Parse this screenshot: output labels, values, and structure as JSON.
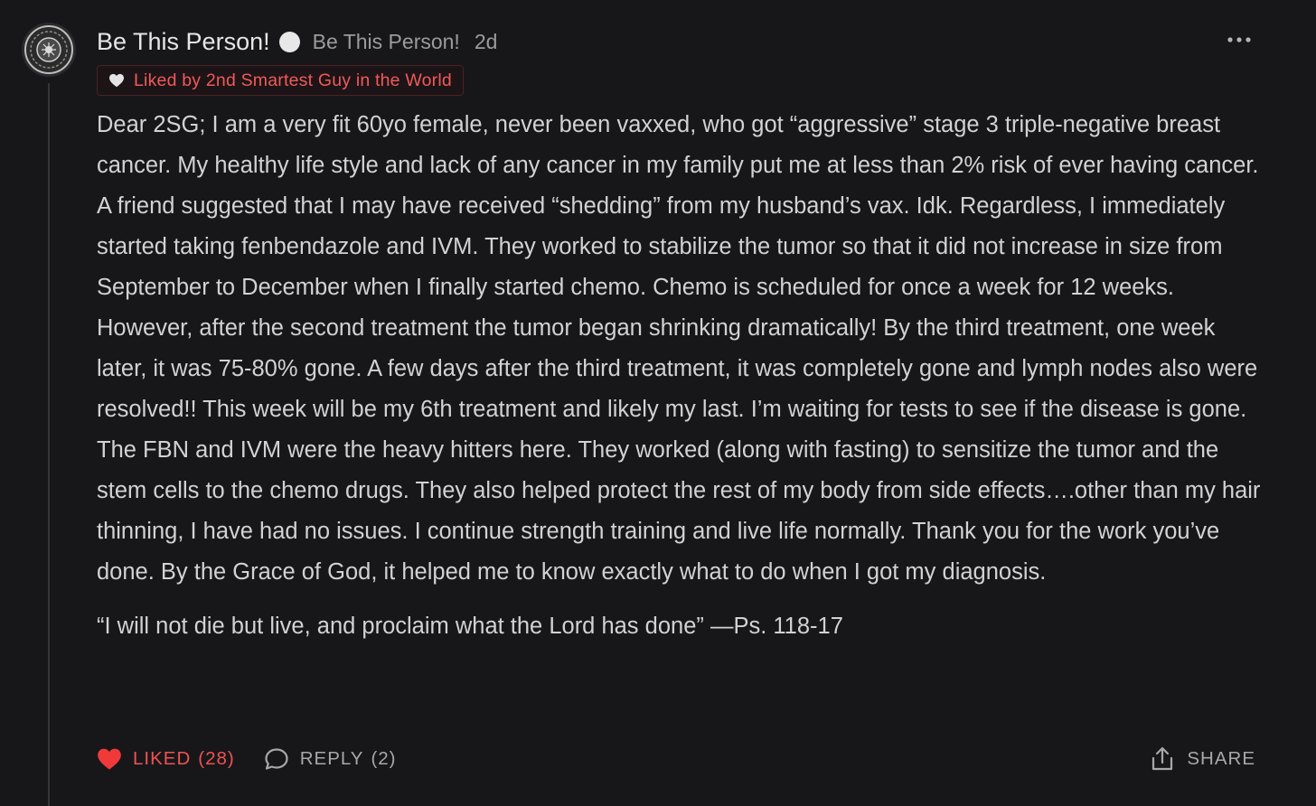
{
  "comment": {
    "author_name": "Be This Person!",
    "author_handle": "Be This Person!",
    "timestamp": "2d",
    "liked_by": "Liked by 2nd Smartest Guy in the World",
    "body_paragraphs": [
      "Dear 2SG; I am a very fit 60yo female, never been vaxxed, who got “aggressive” stage 3 triple-negative breast cancer. My healthy life style and lack of any cancer in my family put me at less than 2% risk of ever having cancer. A friend suggested that I may have received “shedding” from my husband’s vax. Idk. Regardless, I immediately started taking fenbendazole and IVM. They worked to stabilize the tumor so that it did not increase in size from September to December when I finally started chemo. Chemo is scheduled for once a week for 12 weeks. However, after the second treatment the tumor began shrinking dramatically! By the third treatment, one week later, it was 75-80% gone. A few days after the third treatment, it was completely gone and lymph nodes also were resolved!! This week will be my 6th treatment and likely my last. I’m waiting for tests to see if the disease is gone. The FBN and IVM were the heavy hitters here. They worked (along with fasting) to sensitize the tumor and the stem cells to the chemo drugs. They also helped protect the rest of my body from side effects….other than my hair thinning, I have had no issues. I continue strength training and live life normally. Thank you for the work you’ve done. By the Grace of God, it helped me to know exactly what to do when I got my diagnosis.",
      "“I will not die but live, and proclaim what the Lord has done” —Ps. 118-17"
    ]
  },
  "actions": {
    "like_label": "LIKED",
    "like_count": "(28)",
    "reply_label": "REPLY",
    "reply_count": "(2)",
    "share_label": "SHARE"
  },
  "colors": {
    "background": "#17171a",
    "text": "#d2d2d2",
    "muted": "#9b9b9b",
    "accent_red": "#f25252"
  },
  "icons": {
    "avatar": "avatar-image",
    "badge": "subscriber-dot-icon",
    "more": "ellipsis-icon",
    "liked_by": "heart-outline-icon",
    "like": "heart-filled-icon",
    "reply": "speech-bubble-icon",
    "share": "share-upload-icon"
  }
}
